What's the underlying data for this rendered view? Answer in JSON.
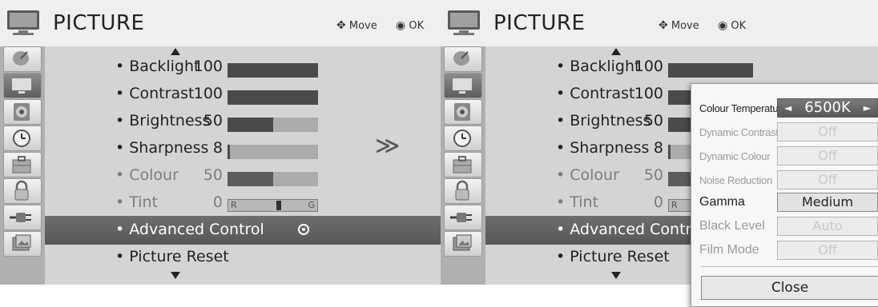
{
  "menu": {
    "title": "PICTURE",
    "hint_move": "Move",
    "hint_ok": "OK",
    "sidebar_icons": [
      "satellite-dish-icon",
      "tv-icon",
      "speaker-icon",
      "clock-icon",
      "toolbox-icon",
      "padlock-icon",
      "input-plug-icon",
      "photo-icon"
    ],
    "active_sidebar_index": 1,
    "items": [
      {
        "label": "• Backlight",
        "value": "100",
        "level": 1.0
      },
      {
        "label": "• Contrast",
        "value": "100",
        "level": 1.0
      },
      {
        "label": "• Brightness",
        "value": "50",
        "level": 0.5
      },
      {
        "label": "• Sharpness",
        "value": "8",
        "level": 0.03
      },
      {
        "label": "• Colour",
        "value": "50",
        "level": 0.5
      },
      {
        "label": "• Tint",
        "value": "0",
        "bar_left": "R",
        "bar_right": "G"
      },
      {
        "label": "• Advanced Control"
      },
      {
        "label": "• Picture Reset"
      }
    ]
  },
  "advanced_popup": {
    "rows": [
      {
        "label": "Colour Temperature",
        "value": "6500K",
        "state": "selected"
      },
      {
        "label": "Dynamic Contrast",
        "value": "Off",
        "state": "disabled"
      },
      {
        "label": "Dynamic Colour",
        "value": "Off",
        "state": "disabled"
      },
      {
        "label": "Noise Reduction",
        "value": "Off",
        "state": "disabled"
      },
      {
        "label": "Gamma",
        "value": "Medium",
        "state": "enabled"
      },
      {
        "label": "Black Level",
        "value": "Auto",
        "state": "disabled"
      },
      {
        "label": "Film Mode",
        "value": "Off",
        "state": "disabled"
      }
    ],
    "left_arrow": "◄",
    "right_arrow": "►",
    "close_label": "Close"
  },
  "transition_glyph": "≫",
  "colors": {
    "header_bg": "#efefef",
    "content_bg": "#d4d4d4",
    "selected_row": "#5e5e5e",
    "bar_fill": "#4a4a4a"
  }
}
